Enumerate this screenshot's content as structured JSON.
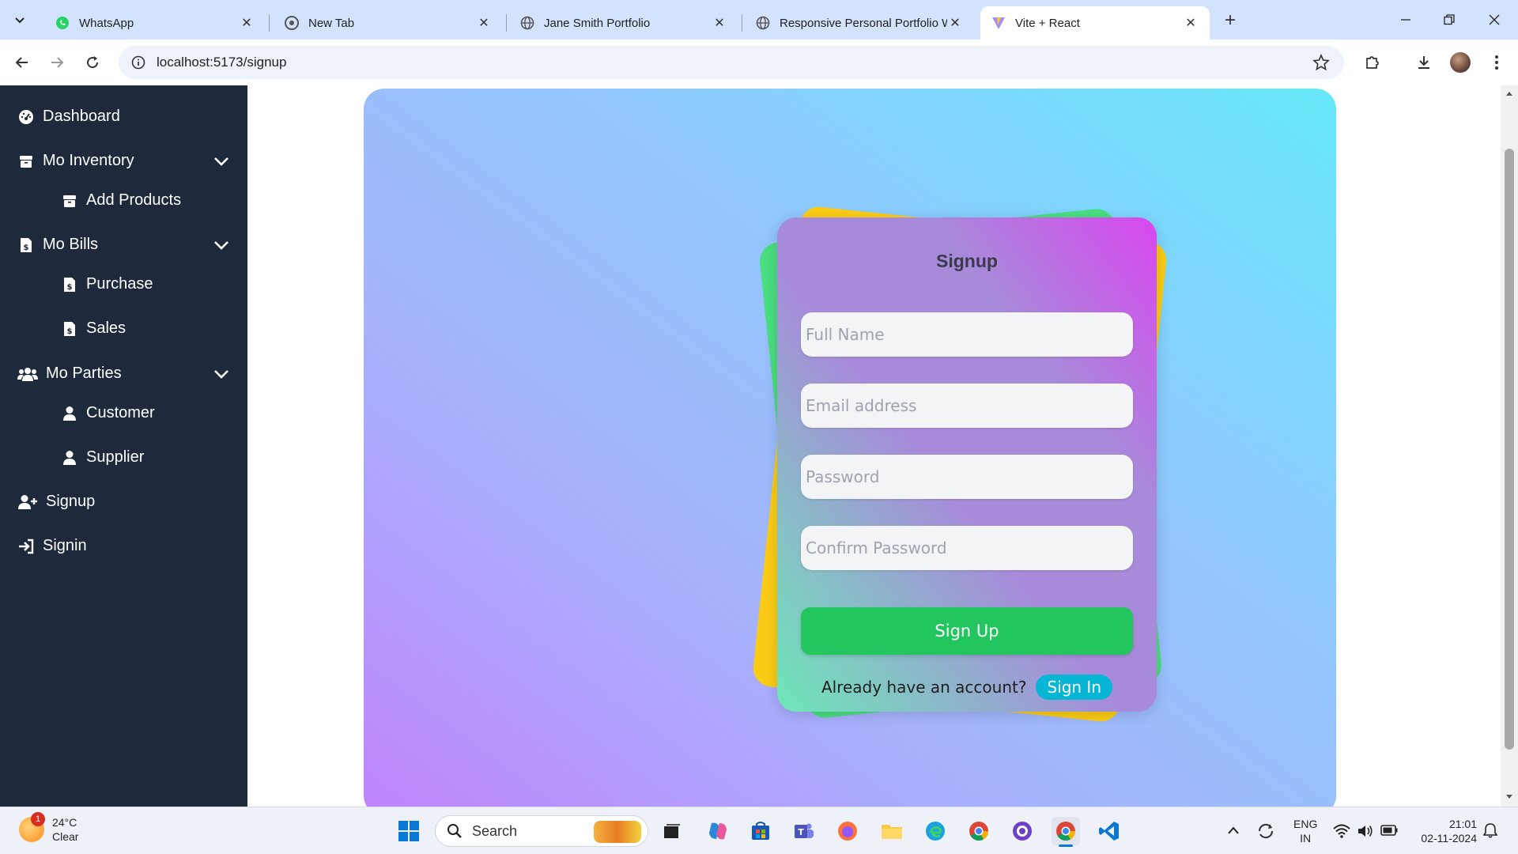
{
  "browser": {
    "tabs": [
      {
        "label": "WhatsApp",
        "icon": "whatsapp-icon"
      },
      {
        "label": "New Tab",
        "icon": "chrome-icon"
      },
      {
        "label": "Jane Smith Portfolio",
        "icon": "globe-icon"
      },
      {
        "label": "Responsive Personal Portfolio W",
        "icon": "globe-icon"
      },
      {
        "label": "Vite + React",
        "icon": "vite-icon",
        "active": true
      }
    ],
    "url": "localhost:5173/signup"
  },
  "sidebar": {
    "items": [
      {
        "label": "Dashboard",
        "icon": "dashboard-icon"
      },
      {
        "label": "Mo Inventory",
        "icon": "box-icon",
        "expandable": true
      },
      {
        "label": "Add Products",
        "icon": "box-icon"
      },
      {
        "label": "Mo Bills",
        "icon": "receipt-icon",
        "expandable": true
      },
      {
        "label": "Purchase",
        "icon": "receipt-icon"
      },
      {
        "label": "Sales",
        "icon": "receipt-icon"
      },
      {
        "label": "Mo Parties",
        "icon": "users-icon",
        "expandable": true
      },
      {
        "label": "Customer",
        "icon": "user-icon"
      },
      {
        "label": "Supplier",
        "icon": "user-icon"
      },
      {
        "label": "Signup",
        "icon": "user-plus-icon"
      },
      {
        "label": "Signin",
        "icon": "sign-in-icon"
      }
    ]
  },
  "form": {
    "title": "Signup",
    "full_name_placeholder": "Full Name",
    "email_placeholder": "Email address",
    "password_placeholder": "Password",
    "confirm_password_placeholder": "Confirm Password",
    "submit_label": "Sign Up",
    "already_text": "Already have an account?",
    "signin_label": "Sign In"
  },
  "taskbar": {
    "weather_temp": "24°C",
    "weather_desc": "Clear",
    "weather_badge": "1",
    "search_label": "Search",
    "lang_line1": "ENG",
    "lang_line2": "IN",
    "time": "21:01",
    "date": "02-11-2024"
  },
  "colors": {
    "sidebar_bg": "#1e293b",
    "signup_button": "#22c55e",
    "signin_link": "#06b6d4"
  }
}
